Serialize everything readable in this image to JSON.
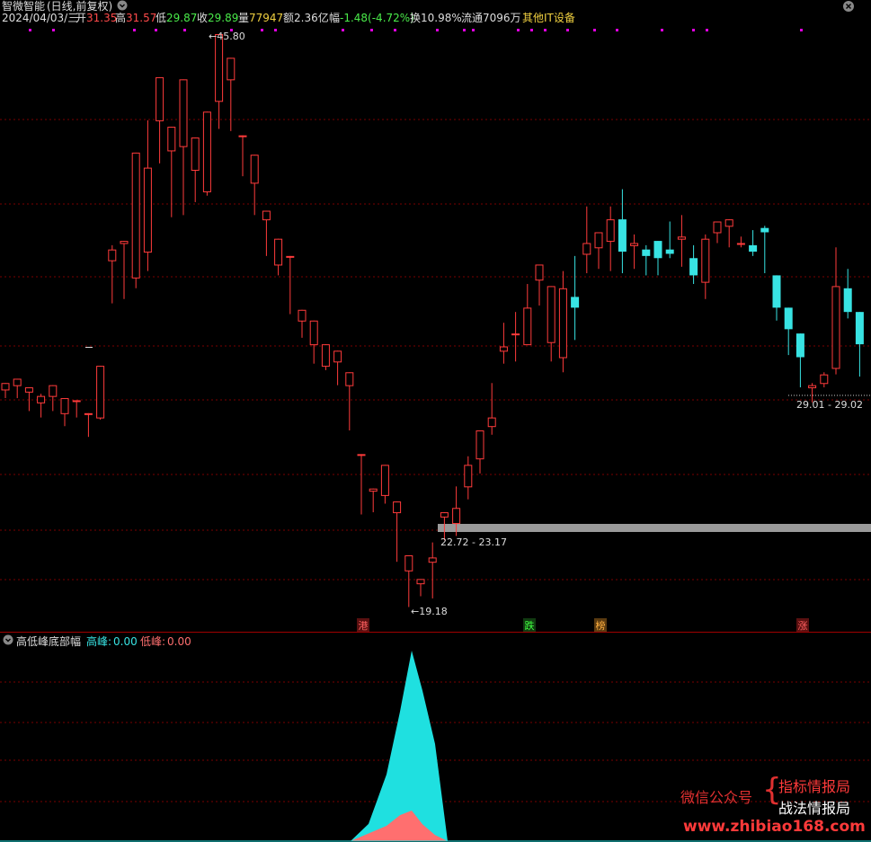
{
  "title": {
    "stock": "智微智能",
    "mode": "(日线,前复权)",
    "icon": "chevron-down-icon"
  },
  "quote": {
    "date": "2024/04/03/三",
    "open_label": "开",
    "open": "31.35",
    "high_label": "高",
    "high": "31.57",
    "low_label": "低",
    "low": "29.87",
    "close_label": "收",
    "close": "29.89",
    "vol_label": "量",
    "vol": "77947",
    "amt_label": "额",
    "amt": "2.36亿",
    "chg_label": "幅",
    "chg": "-1.48(-4.72%)",
    "turn_label": "换",
    "turn": "10.98%",
    "float_label": "流通",
    "float": "7096万",
    "sector": "其他IT设备"
  },
  "close_icon": "close-circle-icon",
  "colors": {
    "up": "#ff3b3b",
    "down": "#38e3e3",
    "grid": "#7a0000",
    "dot": "#e000e0",
    "gray_band": "#9a9a9a",
    "peak_high": "#1fe0e0",
    "peak_low": "#ff6f6f"
  },
  "chart_data": {
    "type": "candlestick",
    "annotations": {
      "high_mark": "45.80",
      "low_mark": "19.18",
      "range_right": "29.01 - 29.02",
      "range_gray": "22.72 - 23.17"
    },
    "events": [
      "港",
      "跌",
      "榜",
      "涨"
    ],
    "ohlc": [
      [
        29.3,
        29.6,
        28.9,
        29.5
      ],
      [
        29.5,
        29.8,
        28.9,
        29.0
      ],
      [
        29.2,
        29.4,
        28.3,
        28.8
      ],
      [
        28.7,
        29.0,
        28.0,
        29.1
      ],
      [
        29.0,
        29.5,
        28.3,
        28.3
      ],
      [
        28.2,
        28.9,
        27.6,
        28.7
      ],
      [
        28.8,
        28.8,
        28.0,
        28.2
      ],
      [
        28.2,
        28.2,
        27.1,
        27.6
      ],
      [
        28.0,
        30.4,
        27.9,
        30.4
      ],
      [
        35.3,
        35.8,
        33.3,
        36.0
      ],
      [
        36.1,
        36.2,
        33.5,
        33.5
      ],
      [
        34.5,
        40.3,
        34.0,
        38.1
      ],
      [
        35.7,
        39.6,
        34.8,
        41.8
      ],
      [
        41.8,
        43.8,
        39.8,
        40.3
      ],
      [
        40.4,
        41.5,
        37.3,
        37.3
      ],
      [
        40.6,
        43.7,
        37.4,
        39.7
      ],
      [
        39.5,
        41.0,
        38.0,
        40.1
      ],
      [
        38.5,
        42.2,
        38.3,
        42.2
      ],
      [
        42.7,
        45.8,
        41.4,
        43.6
      ],
      [
        43.7,
        44.7,
        41.3,
        41.3
      ],
      [
        41.1,
        41.1,
        39.2,
        39.8
      ],
      [
        38.9,
        40.2,
        37.4,
        37.4
      ],
      [
        37.2,
        37.6,
        35.5,
        35.9
      ],
      [
        35.1,
        36.3,
        34.6,
        35.5
      ],
      [
        35.5,
        35.5,
        32.8,
        32.8
      ],
      [
        32.5,
        33.0,
        31.7,
        31.7
      ],
      [
        31.4,
        32.5,
        30.5,
        30.8
      ],
      [
        30.4,
        31.4,
        30.2,
        30.6
      ],
      [
        30.6,
        31.1,
        29.5,
        30.7
      ],
      [
        29.5,
        30.1,
        27.4,
        27.4
      ],
      [
        26.3,
        26.3,
        23.5,
        23.5
      ],
      [
        24.6,
        24.7,
        23.6,
        24.6
      ],
      [
        24.4,
        25.8,
        24.0,
        25.4
      ],
      [
        23.6,
        24.1,
        21.3,
        21.3
      ],
      [
        20.9,
        21.6,
        19.2,
        19.7
      ],
      [
        20.3,
        20.5,
        19.7,
        20.3
      ],
      [
        21.3,
        21.5,
        19.6,
        22.2
      ],
      [
        23.4,
        23.6,
        22.3,
        22.3
      ],
      [
        23.1,
        23.8,
        22.5,
        24.8
      ],
      [
        24.8,
        25.8,
        24.2,
        26.2
      ],
      [
        26.1,
        27.4,
        25.4,
        26.7
      ],
      [
        27.6,
        28.0,
        27.2,
        29.6
      ],
      [
        31.1,
        31.3,
        30.5,
        32.4
      ],
      [
        31.9,
        31.9,
        30.6,
        32.9
      ],
      [
        31.4,
        33.1,
        32.1,
        34.2
      ],
      [
        34.4,
        35.1,
        33.2,
        33.6
      ],
      [
        31.5,
        34.1,
        30.6,
        32.8
      ],
      [
        30.8,
        34.0,
        30.1,
        34.8
      ],
      [
        33.6,
        33.1,
        31.6,
        35.5
      ],
      [
        35.6,
        36.1,
        34.7,
        37.8
      ],
      [
        35.9,
        36.6,
        34.9,
        36.6
      ],
      [
        36.2,
        37.2,
        34.8,
        37.8
      ],
      [
        37.2,
        35.7,
        34.7,
        38.6
      ],
      [
        36.0,
        36.1,
        34.9,
        36.5
      ],
      [
        35.8,
        35.5,
        34.6,
        36.0
      ],
      [
        36.2,
        35.4,
        34.6,
        36.0
      ],
      [
        35.8,
        35.6,
        35.4,
        37.1
      ],
      [
        36.3,
        36.4,
        35.0,
        37.4
      ],
      [
        35.4,
        34.6,
        34.2,
        36.0
      ],
      [
        34.3,
        36.3,
        33.5,
        36.5
      ],
      [
        36.6,
        37.1,
        36.1,
        37.1
      ],
      [
        36.9,
        37.2,
        35.9,
        36.4
      ],
      [
        36.1,
        36.1,
        35.9,
        36.4
      ],
      [
        36.0,
        35.7,
        35.5,
        36.7
      ],
      [
        36.8,
        36.6,
        34.7,
        36.9
      ],
      [
        34.6,
        33.1,
        32.5,
        34.6
      ],
      [
        33.1,
        32.1,
        30.9,
        33.1
      ],
      [
        31.9,
        30.8,
        29.4,
        31.9
      ],
      [
        29.4,
        29.5,
        28.7,
        29.6
      ],
      [
        29.6,
        30.0,
        29.4,
        30.1
      ],
      [
        30.3,
        34.1,
        30.0,
        35.9
      ],
      [
        34.0,
        32.9,
        32.6,
        34.9
      ],
      [
        32.9,
        31.4,
        29.9,
        32.8
      ]
    ],
    "indicator": {
      "name": "高低峰底部幅",
      "high_label": "高峰:",
      "high_value": "0.00",
      "low_label": "低峰:",
      "low_value": "0.00",
      "series": [
        {
          "name": "高峰",
          "values": [
            0,
            0.09,
            0.35,
            0.68,
            1.0,
            0.79,
            0.51,
            0.0
          ]
        },
        {
          "name": "低峰",
          "values": [
            0,
            0.05,
            0.1,
            0.17,
            0.2,
            0.11,
            0.04,
            0.0
          ]
        }
      ]
    }
  },
  "watermark": {
    "wechat": "微信公众号",
    "line1": "指标情报局",
    "line2": "战法情报局",
    "site": "www.zhibiao168.com"
  }
}
